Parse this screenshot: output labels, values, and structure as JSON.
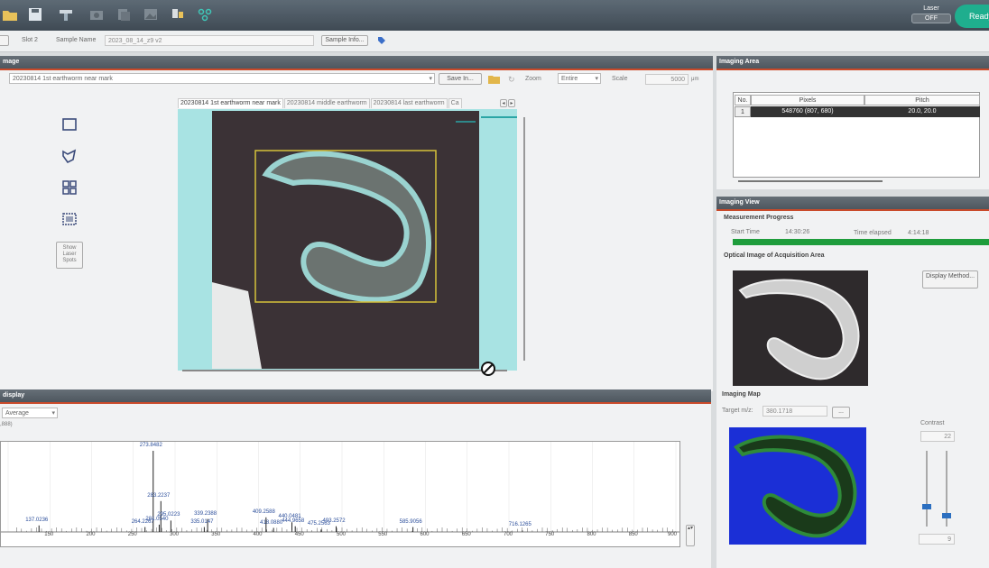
{
  "toolbar": {
    "icons": [
      "folder-open-icon",
      "save-icon",
      "instrument-icon",
      "camera-icon",
      "pages-icon",
      "image-icon",
      "tool-icon",
      "molecule-icon"
    ],
    "laser_label": "Laser",
    "laser_state": "OFF",
    "ready_label": "Ready"
  },
  "slot_bar": {
    "slot_value": "Slot 2",
    "sample_name_label": "Sample Name",
    "sample_name_value": "2023_08_14_z9 v2",
    "sample_info_button": "Sample Info..."
  },
  "image_panel": {
    "header": "mage",
    "file_dropdown": "20230814 1st earthworm near mark",
    "save_button": "Save In...",
    "zoom_label": "Zoom",
    "zoom_value": "Entire",
    "scale_label": "Scale",
    "scale_value": "5000",
    "scale_unit": "μm",
    "show_laser_spots": "Show Laser Spots",
    "tabs": [
      "20230814 1st earthworm near mark",
      "20230814 middle earthworm",
      "20230814 last earthworm",
      "Ca"
    ]
  },
  "imaging_area": {
    "header": "Imaging Area",
    "columns": [
      "No.",
      "Pixels",
      "Pitch"
    ],
    "rows": [
      {
        "no": "1",
        "pixels": "548760 (807, 680)",
        "pitch": "20.0, 20.0"
      }
    ]
  },
  "imaging_view": {
    "header": "Imaging View",
    "measurement_progress": "Measurement Progress",
    "start_time_label": "Start Time",
    "start_time": "14:30:26",
    "time_elapsed_label": "Time elapsed",
    "time_elapsed": "4:14:18",
    "progress_fraction": 1.0,
    "optical_image_label": "Optical Image of Acquisition Area",
    "display_method_button": "Display Method...",
    "imaging_map_label": "Imaging Map",
    "target_mz_label": "Target m/z:",
    "target_mz_value": "380.1718",
    "contrast_label": "Contrast",
    "contrast_top": "22",
    "contrast_bottom": "9",
    "browse_button": "..."
  },
  "spectrum": {
    "header": "display",
    "mode": "Average",
    "intensity_label": ",888)",
    "peak_labels": [
      {
        "text": "137.0236",
        "mz": 137,
        "rel": 0.08
      },
      {
        "text": "264.2267",
        "mz": 264,
        "rel": 0.06
      },
      {
        "text": "283.2237",
        "mz": 283,
        "rel": 0.38
      },
      {
        "text": "273.8482",
        "mz": 273.8,
        "rel": 1.0
      },
      {
        "text": "295.0223",
        "mz": 295,
        "rel": 0.14
      },
      {
        "text": "281.0540",
        "mz": 281,
        "rel": 0.09
      },
      {
        "text": "335.0147",
        "mz": 335,
        "rel": 0.06
      },
      {
        "text": "339.2388",
        "mz": 339,
        "rel": 0.16
      },
      {
        "text": "409.2588",
        "mz": 409,
        "rel": 0.18
      },
      {
        "text": "418.0880",
        "mz": 418,
        "rel": 0.05
      },
      {
        "text": "440.0481",
        "mz": 440,
        "rel": 0.12
      },
      {
        "text": "444.9658",
        "mz": 444,
        "rel": 0.07
      },
      {
        "text": "493.2572",
        "mz": 493,
        "rel": 0.07
      },
      {
        "text": "475.2563",
        "mz": 475,
        "rel": 0.03
      },
      {
        "text": "585.9056",
        "mz": 585,
        "rel": 0.06
      },
      {
        "text": "716.1265",
        "mz": 716,
        "rel": 0.02
      }
    ],
    "x_ticks": [
      "150",
      "200",
      "250",
      "300",
      "350",
      "400",
      "450",
      "500",
      "550",
      "600",
      "650",
      "700",
      "750",
      "800",
      "850",
      "900"
    ]
  }
}
